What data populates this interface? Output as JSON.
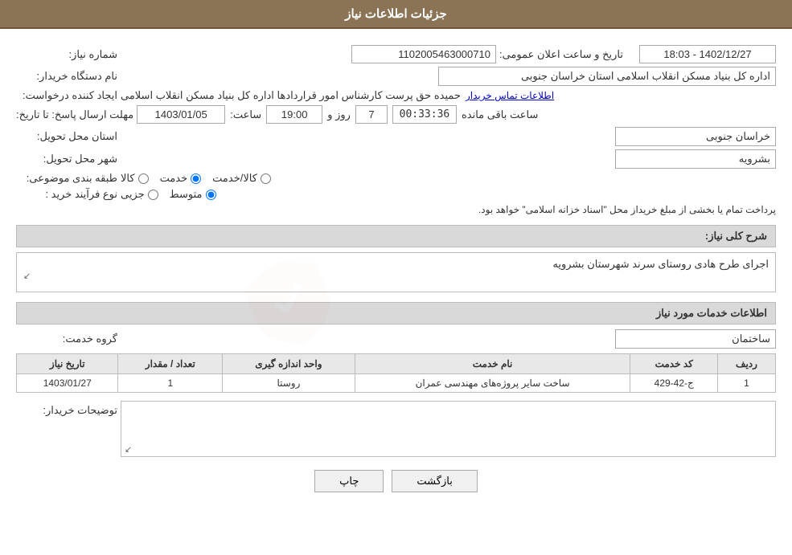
{
  "header": {
    "title": "جزئیات اطلاعات نیاز"
  },
  "fields": {
    "need_number_label": "شماره نیاز:",
    "need_number_value": "1102005463000710",
    "announcement_label": "تاریخ و ساعت اعلان عمومی:",
    "announcement_value": "1402/12/27 - 18:03",
    "buyer_org_label": "نام دستگاه خریدار:",
    "buyer_org_value": "اداره کل بنیاد مسکن انقلاب اسلامی استان خراسان جنوبی",
    "creator_label": "ایجاد کننده درخواست:",
    "creator_value": "حمیده حق پرست کارشناس امور قراردادها اداره کل بنیاد مسکن انقلاب اسلامی",
    "creator_link": "اطلاعات تماس خریدار",
    "deadline_label": "مهلت ارسال پاسخ: تا تاریخ:",
    "deadline_date": "1403/01/05",
    "deadline_time_label": "ساعت:",
    "deadline_time": "19:00",
    "deadline_days_label": "روز و",
    "deadline_days": "7",
    "remaining_label": "ساعت باقی مانده",
    "remaining_time": "00:33:36",
    "province_label": "استان محل تحویل:",
    "province_value": "خراسان جنوبی",
    "city_label": "شهر محل تحویل:",
    "city_value": "بشرویه",
    "category_label": "طبقه بندی موضوعی:",
    "category_options": [
      {
        "id": "kala",
        "label": "کالا"
      },
      {
        "id": "khadamat",
        "label": "خدمت"
      },
      {
        "id": "kala_khadamat",
        "label": "کالا/خدمت"
      }
    ],
    "category_selected": "khadamat",
    "process_label": "نوع فرآیند خرید :",
    "process_options": [
      {
        "id": "jozvi",
        "label": "جزیی"
      },
      {
        "id": "mottaset",
        "label": "متوسط"
      }
    ],
    "process_selected": "mottaset",
    "process_description": "پرداخت تمام یا بخشی از مبلغ خریداز محل \"اسناد خزانه اسلامی\" خواهد بود.",
    "need_desc_label": "شرح کلی نیاز:",
    "need_desc_value": "اجرای طرح هادی روستای سرند شهرستان بشرویه",
    "services_section_label": "اطلاعات خدمات مورد نیاز",
    "service_group_label": "گروه خدمت:",
    "service_group_value": "ساختمان",
    "services_table": {
      "columns": [
        "ردیف",
        "کد خدمت",
        "نام خدمت",
        "واحد اندازه گیری",
        "تعداد / مقدار",
        "تاریخ نیاز"
      ],
      "rows": [
        {
          "row": "1",
          "code": "ج-42-429",
          "name": "ساخت سایر پروژه‌های مهندسی عمران",
          "unit": "روستا",
          "qty": "1",
          "date": "1403/01/27"
        }
      ]
    },
    "buyer_desc_label": "توضیحات خریدار:",
    "buyer_desc_value": "",
    "btn_print": "چاپ",
    "btn_back": "بازگشت"
  }
}
